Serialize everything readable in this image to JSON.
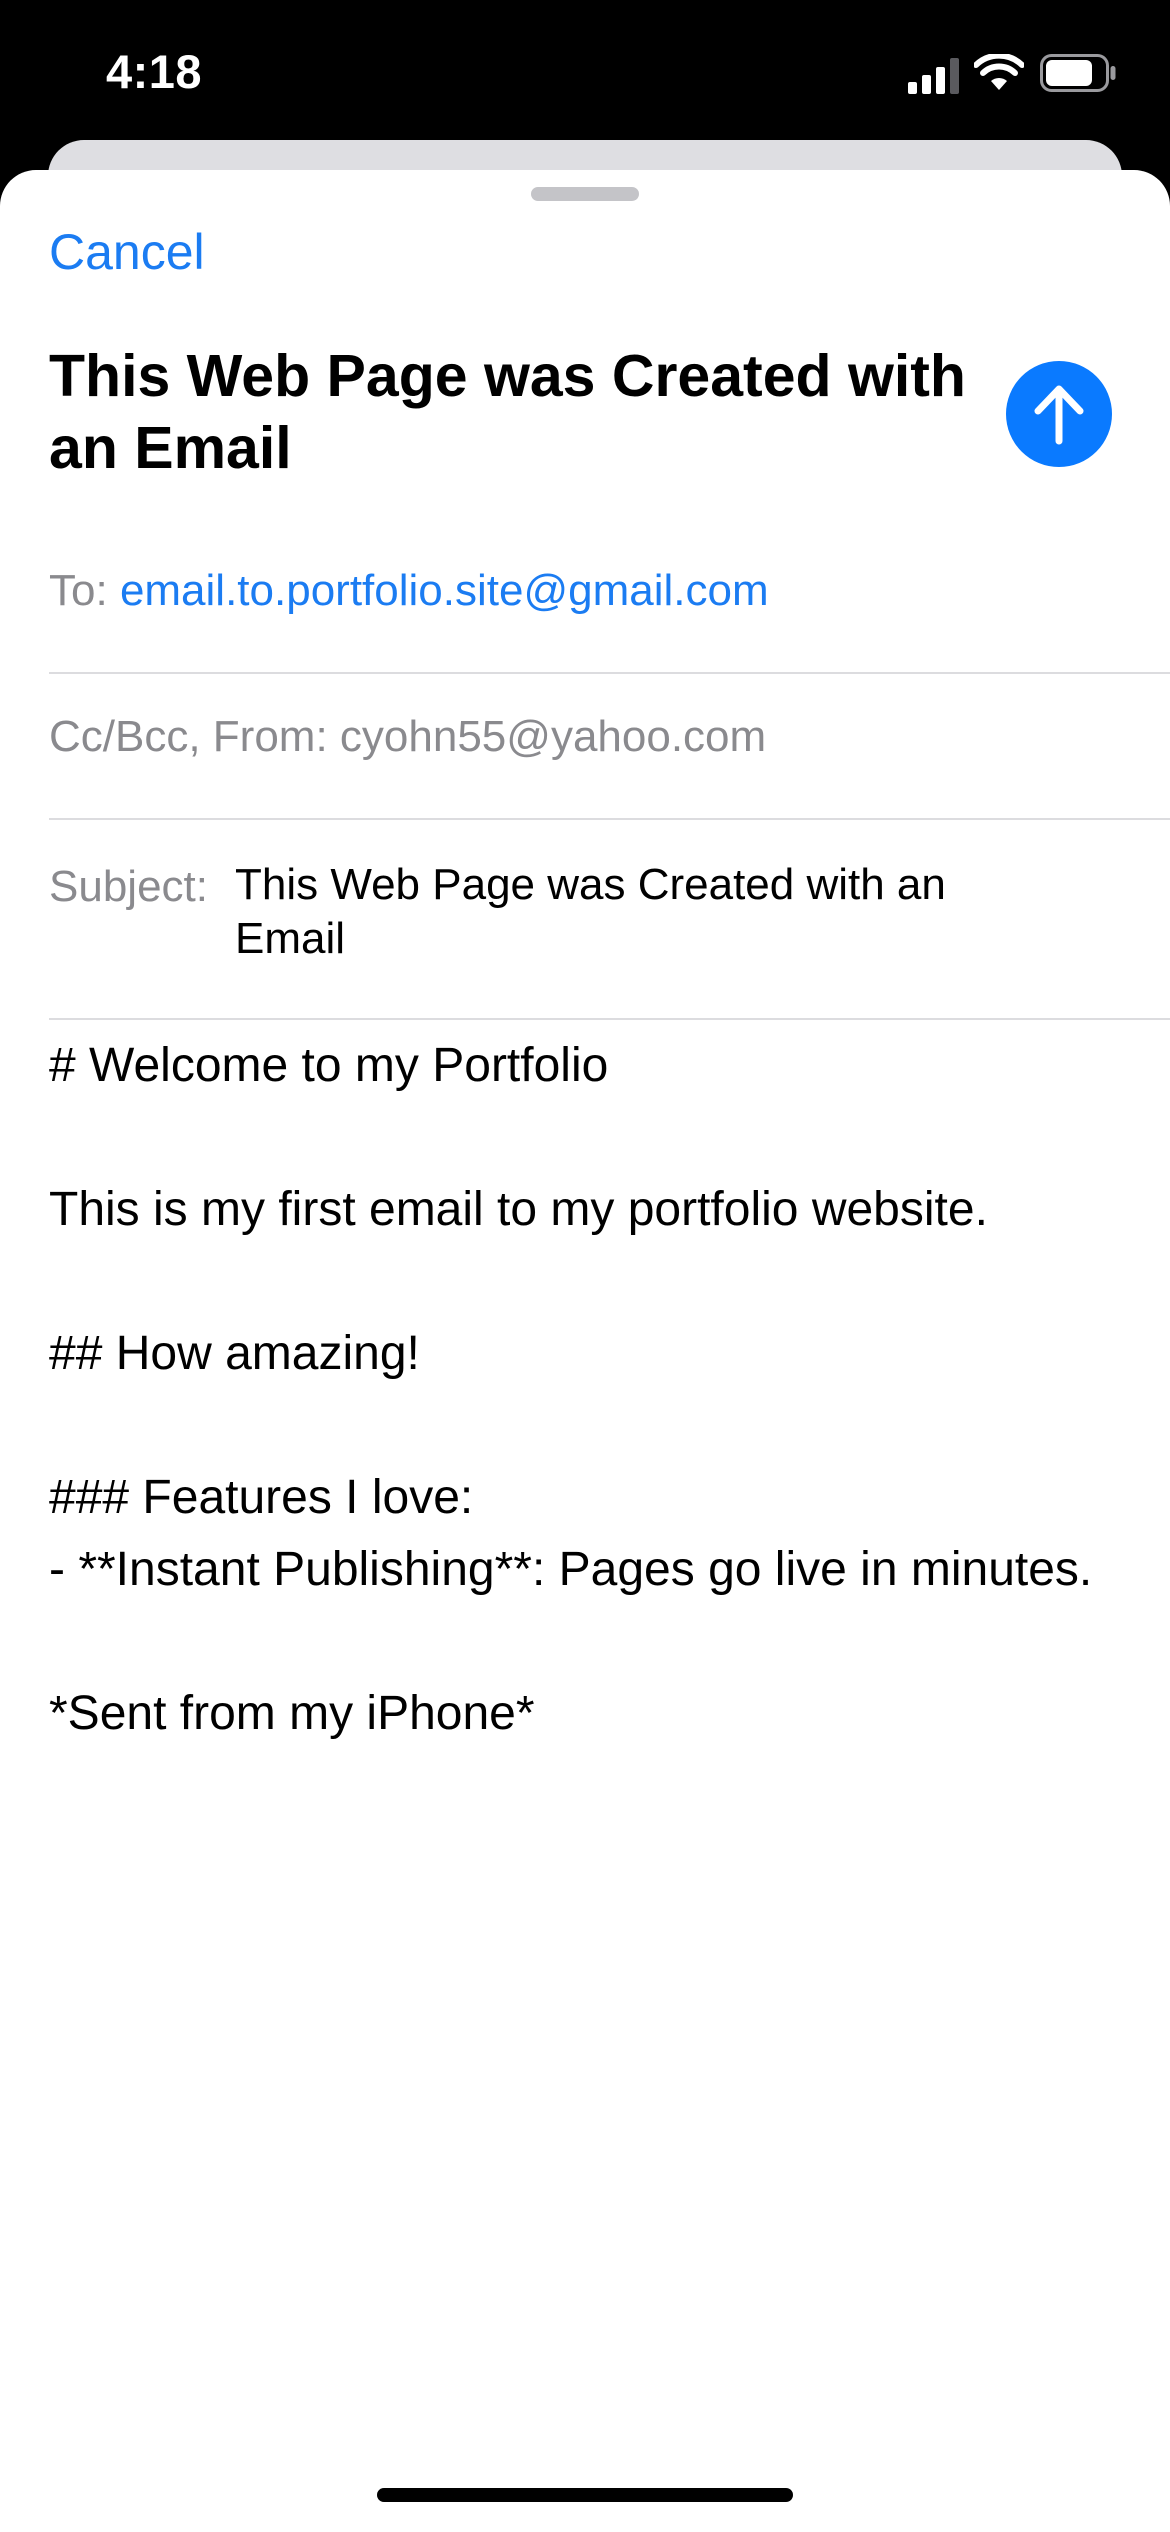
{
  "status_bar": {
    "time": "4:18",
    "icons": [
      "cellular-signal-icon",
      "wifi-icon",
      "battery-icon"
    ]
  },
  "compose": {
    "cancel_label": "Cancel",
    "title": "This Web Page was Created with an Email",
    "send_icon": "arrow-up-icon",
    "to_label": "To:",
    "to_value": "email.to.portfolio.site@gmail.com",
    "cc_label": "Cc/Bcc, From:",
    "from_value": "cyohn55@yahoo.com",
    "subject_label": "Subject:",
    "subject_value": "This Web Page was Created with an Email",
    "body": "# Welcome to my Portfolio\n\nThis is my first email to my portfolio website.\n\n## How amazing!\n\n### Features I love:\n- **Instant Publishing**: Pages go live in minutes.\n\n*Sent from my iPhone*"
  },
  "colors": {
    "accent": "#1b7cf2",
    "send_button": "#0a7aff",
    "secondary_text": "#8a8a8e",
    "divider": "#dcdcdf"
  }
}
